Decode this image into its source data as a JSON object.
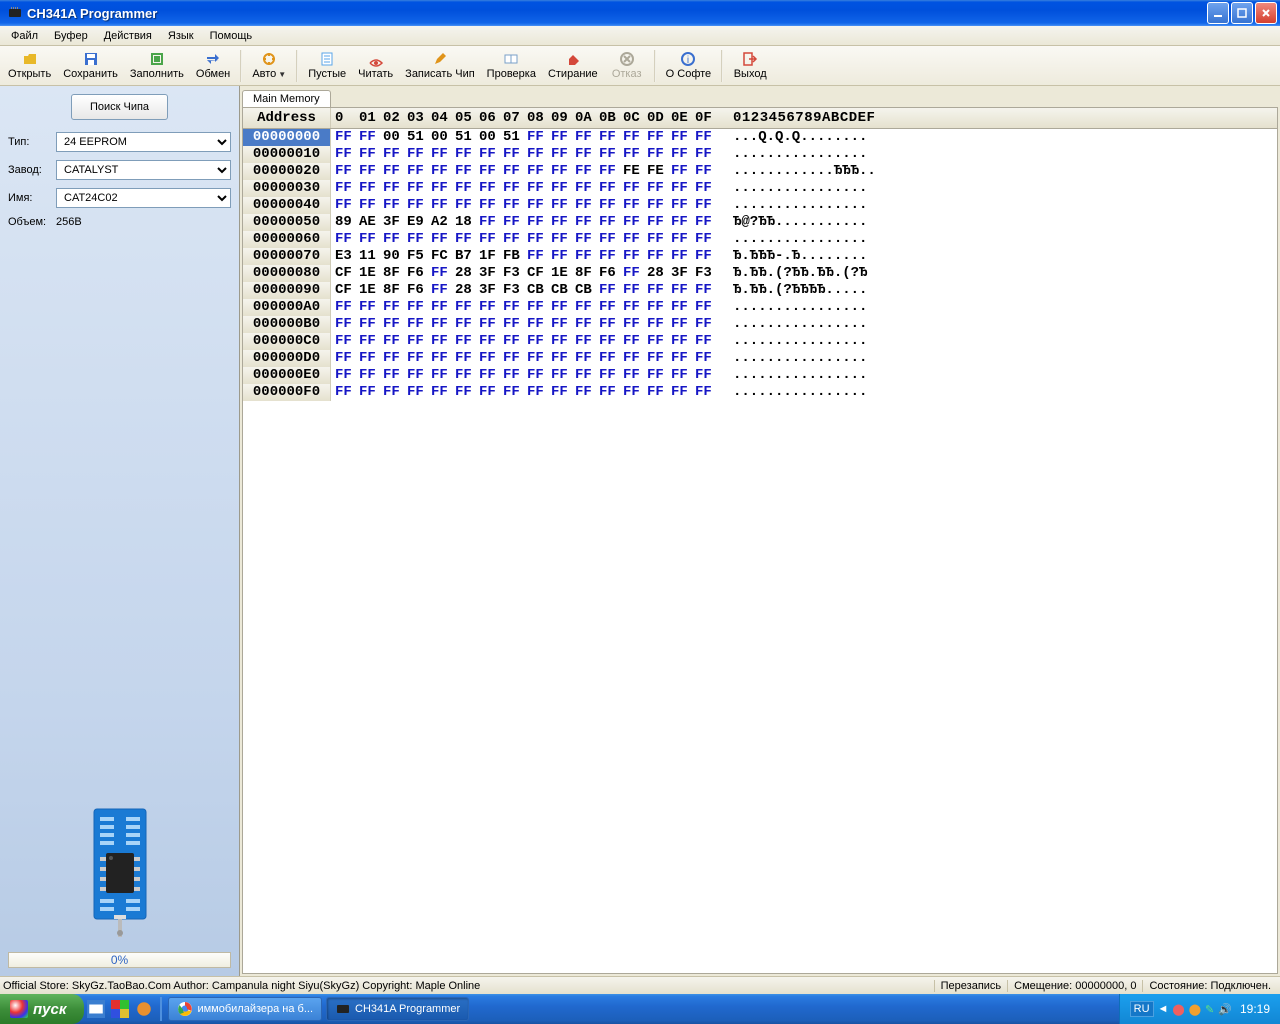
{
  "window": {
    "title": "CH341A Programmer"
  },
  "menu": [
    "Файл",
    "Буфер",
    "Действия",
    "Язык",
    "Помощь"
  ],
  "toolbar": [
    {
      "label": "Открыть",
      "icon": "open",
      "color": "#e8b828"
    },
    {
      "label": "Сохранить",
      "icon": "save",
      "color": "#3a6fcf"
    },
    {
      "label": "Заполнить",
      "icon": "fill",
      "color": "#4aa54a"
    },
    {
      "label": "Обмен",
      "icon": "swap",
      "color": "#3a6fcf"
    },
    {
      "sep": true
    },
    {
      "label": "Авто",
      "icon": "auto",
      "color": "#e0941a",
      "dropdown": true
    },
    {
      "sep": true
    },
    {
      "label": "Пустые",
      "icon": "empty",
      "color": "#5aa5e8"
    },
    {
      "label": "Читать",
      "icon": "read",
      "color": "#d4483a"
    },
    {
      "label": "Записать Чип",
      "icon": "write",
      "color": "#e0941a"
    },
    {
      "label": "Проверка",
      "icon": "verify",
      "color": "#7aa0c8"
    },
    {
      "label": "Стирание",
      "icon": "erase",
      "color": "#d4483a"
    },
    {
      "label": "Отказ",
      "icon": "cancel",
      "color": "#aca899",
      "disabled": true
    },
    {
      "sep": true
    },
    {
      "label": "О Софте",
      "icon": "about",
      "color": "#3a6fcf"
    },
    {
      "sep": true
    },
    {
      "label": "Выход",
      "icon": "exit",
      "color": "#d4483a"
    }
  ],
  "sidebar": {
    "search_label": "Поиск Чипа",
    "type_label": "Тип:",
    "type_value": "24 EEPROM",
    "manuf_label": "Завод:",
    "manuf_value": "CATALYST",
    "name_label": "Имя:",
    "name_value": "CAT24C02",
    "size_label": "Объем:",
    "size_value": "256B",
    "progress": "0%"
  },
  "tab_name": "Main Memory",
  "hex_header": {
    "addr": "Address",
    "cols": [
      "0",
      "01",
      "02",
      "03",
      "04",
      "05",
      "06",
      "07",
      "08",
      "09",
      "0A",
      "0B",
      "0C",
      "0D",
      "0E",
      "0F"
    ],
    "ascii": "0123456789ABCDEF"
  },
  "hex_rows": [
    {
      "addr": "00000000",
      "sel": true,
      "b": [
        "FF",
        "FF",
        "00",
        "51",
        "00",
        "51",
        "00",
        "51",
        "FF",
        "FF",
        "FF",
        "FF",
        "FF",
        "FF",
        "FF",
        "FF"
      ],
      "a": "...Q.Q.Q........"
    },
    {
      "addr": "00000010",
      "b": [
        "FF",
        "FF",
        "FF",
        "FF",
        "FF",
        "FF",
        "FF",
        "FF",
        "FF",
        "FF",
        "FF",
        "FF",
        "FF",
        "FF",
        "FF",
        "FF"
      ],
      "a": "................"
    },
    {
      "addr": "00000020",
      "b": [
        "FF",
        "FF",
        "FF",
        "FF",
        "FF",
        "FF",
        "FF",
        "FF",
        "FF",
        "FF",
        "FF",
        "FF",
        "FE",
        "FE",
        "FF",
        "FF"
      ],
      "a": "............ЂЂЂ.."
    },
    {
      "addr": "00000030",
      "b": [
        "FF",
        "FF",
        "FF",
        "FF",
        "FF",
        "FF",
        "FF",
        "FF",
        "FF",
        "FF",
        "FF",
        "FF",
        "FF",
        "FF",
        "FF",
        "FF"
      ],
      "a": "................"
    },
    {
      "addr": "00000040",
      "b": [
        "FF",
        "FF",
        "FF",
        "FF",
        "FF",
        "FF",
        "FF",
        "FF",
        "FF",
        "FF",
        "FF",
        "FF",
        "FF",
        "FF",
        "FF",
        "FF"
      ],
      "a": "................"
    },
    {
      "addr": "00000050",
      "b": [
        "89",
        "AE",
        "3F",
        "E9",
        "A2",
        "18",
        "FF",
        "FF",
        "FF",
        "FF",
        "FF",
        "FF",
        "FF",
        "FF",
        "FF",
        "FF"
      ],
      "a": "Ђ@?ЂЂ..........."
    },
    {
      "addr": "00000060",
      "b": [
        "FF",
        "FF",
        "FF",
        "FF",
        "FF",
        "FF",
        "FF",
        "FF",
        "FF",
        "FF",
        "FF",
        "FF",
        "FF",
        "FF",
        "FF",
        "FF"
      ],
      "a": "................"
    },
    {
      "addr": "00000070",
      "b": [
        "E3",
        "11",
        "90",
        "F5",
        "FC",
        "B7",
        "1F",
        "FB",
        "FF",
        "FF",
        "FF",
        "FF",
        "FF",
        "FF",
        "FF",
        "FF"
      ],
      "a": "Ђ.ЂЂЂ-.Ђ........"
    },
    {
      "addr": "00000080",
      "b": [
        "CF",
        "1E",
        "8F",
        "F6",
        "FF",
        "28",
        "3F",
        "F3",
        "CF",
        "1E",
        "8F",
        "F6",
        "FF",
        "28",
        "3F",
        "F3"
      ],
      "a": "Ђ.ЂЂ.(?ЂЂ.ЂЂ.(?Ђ"
    },
    {
      "addr": "00000090",
      "b": [
        "CF",
        "1E",
        "8F",
        "F6",
        "FF",
        "28",
        "3F",
        "F3",
        "CB",
        "CB",
        "CB",
        "FF",
        "FF",
        "FF",
        "FF",
        "FF"
      ],
      "a": "Ђ.ЂЂ.(?ЂЂЂЂ....."
    },
    {
      "addr": "000000A0",
      "b": [
        "FF",
        "FF",
        "FF",
        "FF",
        "FF",
        "FF",
        "FF",
        "FF",
        "FF",
        "FF",
        "FF",
        "FF",
        "FF",
        "FF",
        "FF",
        "FF"
      ],
      "a": "................"
    },
    {
      "addr": "000000B0",
      "b": [
        "FF",
        "FF",
        "FF",
        "FF",
        "FF",
        "FF",
        "FF",
        "FF",
        "FF",
        "FF",
        "FF",
        "FF",
        "FF",
        "FF",
        "FF",
        "FF"
      ],
      "a": "................"
    },
    {
      "addr": "000000C0",
      "b": [
        "FF",
        "FF",
        "FF",
        "FF",
        "FF",
        "FF",
        "FF",
        "FF",
        "FF",
        "FF",
        "FF",
        "FF",
        "FF",
        "FF",
        "FF",
        "FF"
      ],
      "a": "................"
    },
    {
      "addr": "000000D0",
      "b": [
        "FF",
        "FF",
        "FF",
        "FF",
        "FF",
        "FF",
        "FF",
        "FF",
        "FF",
        "FF",
        "FF",
        "FF",
        "FF",
        "FF",
        "FF",
        "FF"
      ],
      "a": "................"
    },
    {
      "addr": "000000E0",
      "b": [
        "FF",
        "FF",
        "FF",
        "FF",
        "FF",
        "FF",
        "FF",
        "FF",
        "FF",
        "FF",
        "FF",
        "FF",
        "FF",
        "FF",
        "FF",
        "FF"
      ],
      "a": "................"
    },
    {
      "addr": "000000F0",
      "b": [
        "FF",
        "FF",
        "FF",
        "FF",
        "FF",
        "FF",
        "FF",
        "FF",
        "FF",
        "FF",
        "FF",
        "FF",
        "FF",
        "FF",
        "FF",
        "FF"
      ],
      "a": "................"
    }
  ],
  "statusbar": {
    "left": "Official Store: SkyGz.TaoBao.Com Author: Campanula night Siyu(SkyGz) Copyright: Maple Online",
    "overwrite": "Перезапись",
    "offset": "Смещение: 00000000, 0",
    "state": "Состояние: Подключен."
  },
  "taskbar": {
    "start": "пуск",
    "tasks": [
      {
        "label": "иммобилайзера на б...",
        "active": false,
        "chrome": true
      },
      {
        "label": "CH341A Programmer",
        "active": true,
        "chrome": false
      }
    ],
    "lang": "RU",
    "clock": "19:19"
  }
}
